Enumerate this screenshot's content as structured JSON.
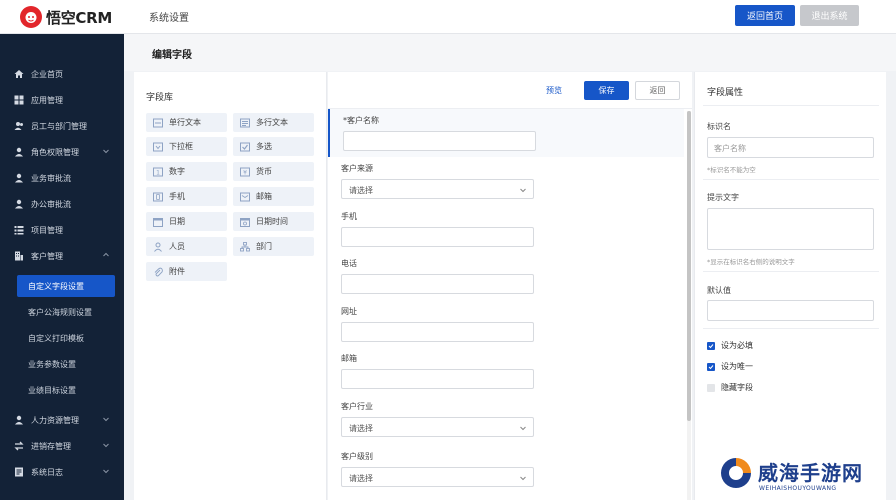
{
  "header": {
    "logo_text": "悟空CRM",
    "title": "系统设置",
    "home_button": "返回首页",
    "logout_button": "退出系统"
  },
  "sidebar": {
    "items": [
      {
        "label": "企业首页",
        "icon": "home-icon"
      },
      {
        "label": "应用管理",
        "icon": "grid-icon"
      },
      {
        "label": "员工与部门管理",
        "icon": "users-icon"
      },
      {
        "label": "角色权限管理",
        "icon": "user-shield-icon",
        "chevron": true
      },
      {
        "label": "业务审批流",
        "icon": "user-icon"
      },
      {
        "label": "办公审批流",
        "icon": "user-icon"
      },
      {
        "label": "项目管理",
        "icon": "list-icon"
      },
      {
        "label": "客户管理",
        "icon": "building-icon",
        "chevron": true,
        "expanded": true
      }
    ],
    "sub_items": [
      {
        "label": "自定义字段设置",
        "active": true
      },
      {
        "label": "客户公海规则设置"
      },
      {
        "label": "自定义打印模板"
      },
      {
        "label": "业务参数设置"
      },
      {
        "label": "业绩目标设置"
      }
    ],
    "bottom_items": [
      {
        "label": "人力资源管理",
        "icon": "user-icon",
        "chevron": true
      },
      {
        "label": "进销存管理",
        "icon": "swap-icon",
        "chevron": true
      },
      {
        "label": "系统日志",
        "icon": "log-icon",
        "chevron": true
      }
    ]
  },
  "page": {
    "title": "编辑字段"
  },
  "library": {
    "title": "字段库",
    "chips": [
      {
        "label": "单行文本",
        "icon": "text-line-icon"
      },
      {
        "label": "多行文本",
        "icon": "text-multi-icon"
      },
      {
        "label": "下拉框",
        "icon": "dropdown-icon"
      },
      {
        "label": "多选",
        "icon": "checkbox-icon"
      },
      {
        "label": "数字",
        "icon": "number-icon"
      },
      {
        "label": "货币",
        "icon": "currency-icon"
      },
      {
        "label": "手机",
        "icon": "phone-icon"
      },
      {
        "label": "邮箱",
        "icon": "mail-icon"
      },
      {
        "label": "日期",
        "icon": "calendar-icon"
      },
      {
        "label": "日期时间",
        "icon": "datetime-icon"
      },
      {
        "label": "人员",
        "icon": "person-icon"
      },
      {
        "label": "部门",
        "icon": "org-icon"
      },
      {
        "label": "附件",
        "icon": "paperclip-icon"
      }
    ]
  },
  "form": {
    "preview": "预览",
    "save": "保存",
    "back": "返回",
    "fields": [
      {
        "label": "*客户名称",
        "type": "input",
        "selected": true
      },
      {
        "label": "客户来源",
        "type": "select",
        "value": "请选择"
      },
      {
        "label": "手机",
        "type": "input"
      },
      {
        "label": "电话",
        "type": "input"
      },
      {
        "label": "网址",
        "type": "input"
      },
      {
        "label": "邮箱",
        "type": "input"
      },
      {
        "label": "客户行业",
        "type": "select",
        "value": "请选择"
      },
      {
        "label": "客户级别",
        "type": "select",
        "value": "请选择"
      }
    ]
  },
  "props": {
    "title": "字段属性",
    "name_label": "标识名",
    "name_value": "客户名称",
    "name_hint": "*标识名不能为空",
    "tip_label": "提示文字",
    "tip_hint": "*显示在标识名右侧的说明文字",
    "default_label": "默认值",
    "checks": [
      {
        "label": "设为必填",
        "checked": true
      },
      {
        "label": "设为唯一",
        "checked": true
      },
      {
        "label": "隐藏字段",
        "checked": false
      }
    ]
  },
  "watermark": {
    "text": "威海手游网",
    "sub": "WEIHAISHOUYOUWANG"
  },
  "colors": {
    "primary": "#1656c8",
    "sidebar": "#132237",
    "brand_red": "#e2262b"
  }
}
